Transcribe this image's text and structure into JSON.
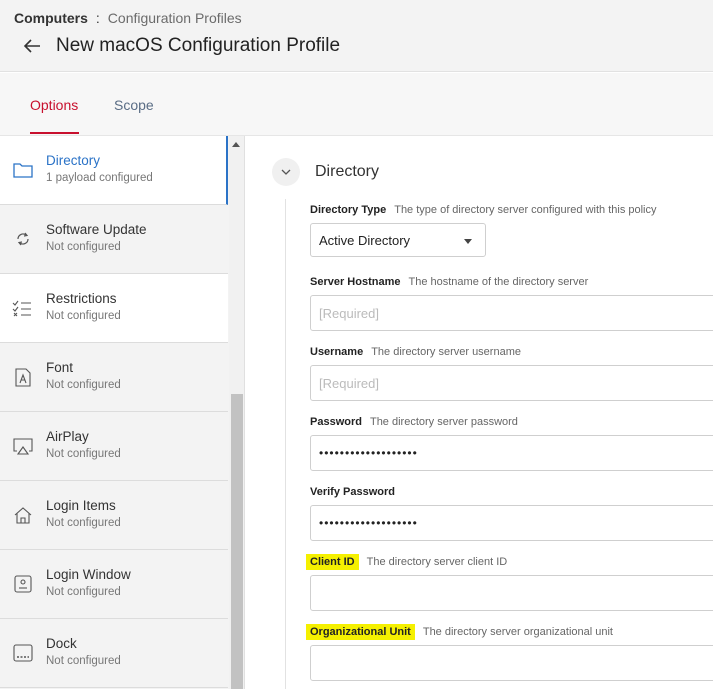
{
  "header": {
    "breadcrumb_root": "Computers",
    "breadcrumb_sep": ":",
    "breadcrumb_current": "Configuration Profiles",
    "title": "New macOS Configuration Profile"
  },
  "tabs": [
    {
      "label": "Options"
    },
    {
      "label": "Scope"
    }
  ],
  "sidebar": {
    "items": [
      {
        "label": "Directory",
        "status": "1 payload configured",
        "icon": "folder-icon"
      },
      {
        "label": "Software Update",
        "status": "Not configured",
        "icon": "refresh-icon"
      },
      {
        "label": "Restrictions",
        "status": "Not configured",
        "icon": "checklist-icon"
      },
      {
        "label": "Font",
        "status": "Not configured",
        "icon": "font-icon"
      },
      {
        "label": "AirPlay",
        "status": "Not configured",
        "icon": "airplay-icon"
      },
      {
        "label": "Login Items",
        "status": "Not configured",
        "icon": "home-icon"
      },
      {
        "label": "Login Window",
        "status": "Not configured",
        "icon": "login-window-icon"
      },
      {
        "label": "Dock",
        "status": "Not configured",
        "icon": "dock-icon"
      }
    ]
  },
  "main": {
    "section_title": "Directory",
    "fields": {
      "directory_type": {
        "label": "Directory Type",
        "desc": "The type of directory server configured with this policy",
        "value": "Active Directory"
      },
      "server_hostname": {
        "label": "Server Hostname",
        "desc": "The hostname of the directory server",
        "placeholder": "[Required]"
      },
      "username": {
        "label": "Username",
        "desc": "The directory server username",
        "placeholder": "[Required]"
      },
      "password": {
        "label": "Password",
        "desc": "The directory server password",
        "value": "•••••••••••••••••••"
      },
      "verify_password": {
        "label": "Verify Password",
        "value": "•••••••••••••••••••"
      },
      "client_id": {
        "label": "Client ID",
        "desc": "The directory server client ID",
        "value": ""
      },
      "org_unit": {
        "label": "Organizational Unit",
        "desc": "The directory server organizational unit",
        "value": ""
      }
    }
  },
  "colors": {
    "accent_red": "#c8102e",
    "link_blue": "#2b73c7",
    "highlight_yellow": "#f5f000"
  }
}
